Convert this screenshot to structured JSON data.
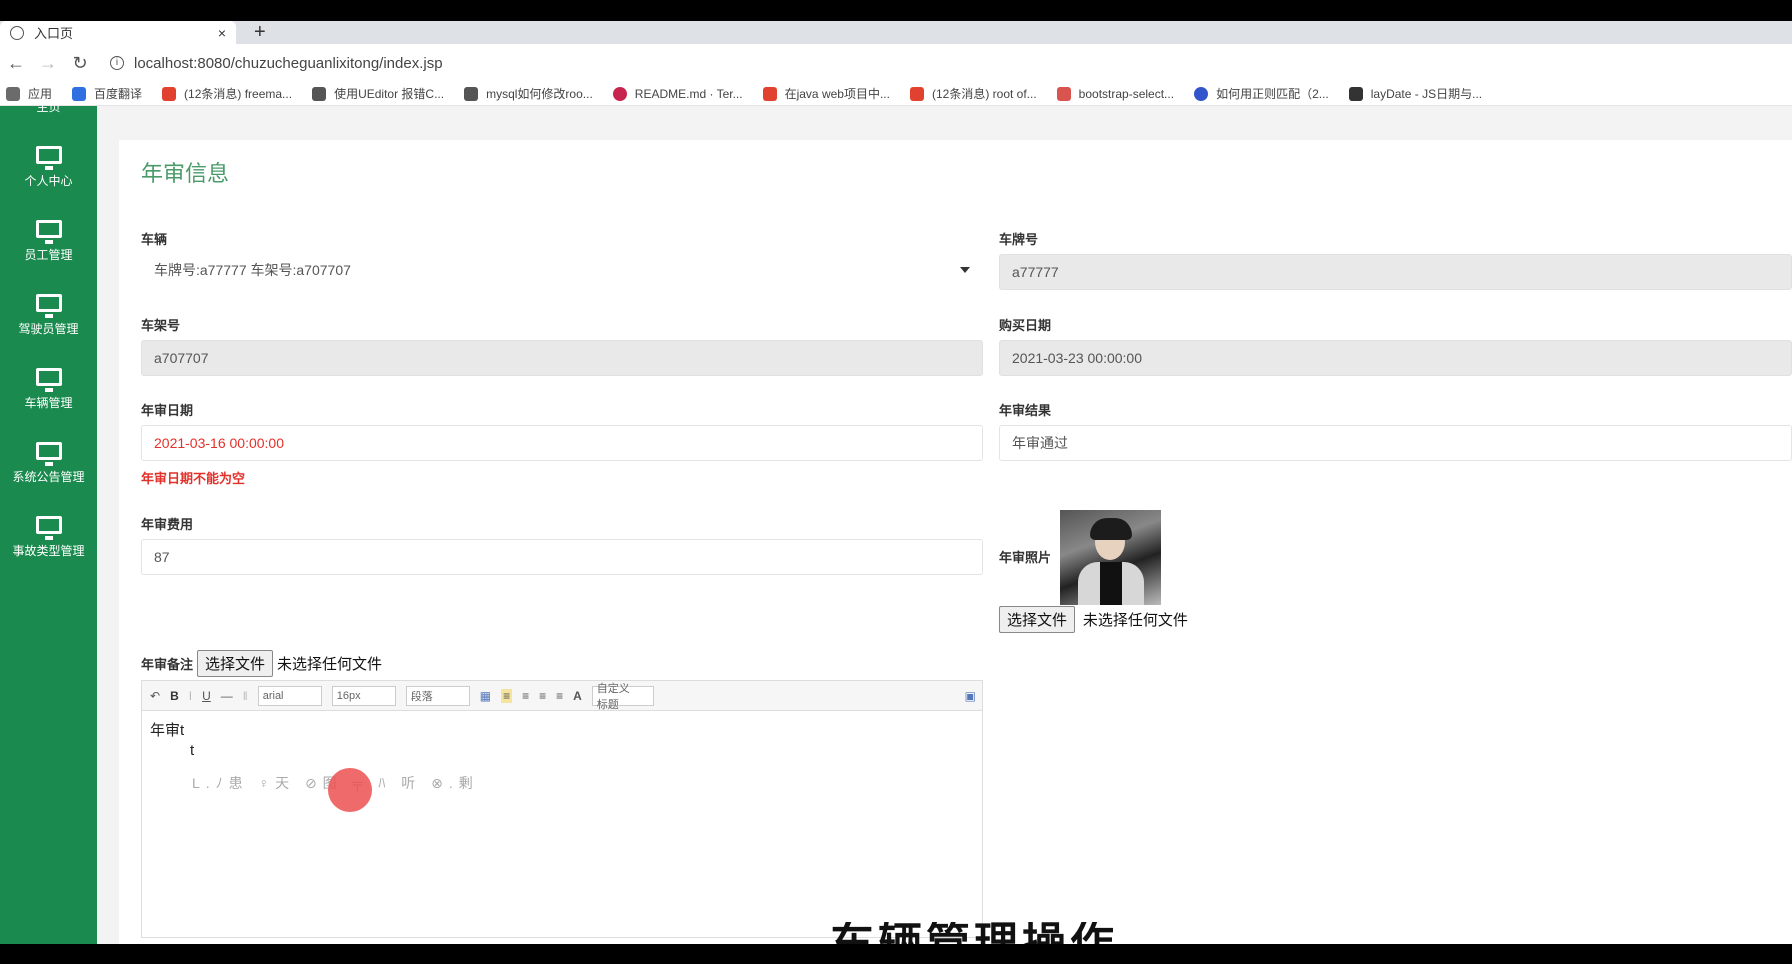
{
  "browser": {
    "tab_title": "入口页",
    "tab_close": "×",
    "new_tab": "+",
    "url": "localhost:8080/chuzucheguanlixitong/index.jsp",
    "bookmarks": [
      {
        "label": "应用",
        "color": "#6b6b6b"
      },
      {
        "label": "百度翻译",
        "color": "#2f6fe0"
      },
      {
        "label": "(12条消息) freema...",
        "color": "#e0422f"
      },
      {
        "label": "使用UEditor 报错C...",
        "color": "#555555"
      },
      {
        "label": "mysql如何修改roo...",
        "color": "#555555"
      },
      {
        "label": "README.md · Ter...",
        "color": "#c7254e"
      },
      {
        "label": "在java web项目中...",
        "color": "#e0422f"
      },
      {
        "label": "(12条消息) root of...",
        "color": "#e0422f"
      },
      {
        "label": "bootstrap-select...",
        "color": "#d9534f"
      },
      {
        "label": "如何用正则匹配（2...",
        "color": "#3355cc"
      },
      {
        "label": "layDate - JS日期与...",
        "color": "#333333"
      }
    ]
  },
  "sidebar": {
    "top_partial": "主页",
    "items": [
      {
        "label": "个人中心"
      },
      {
        "label": "员工管理"
      },
      {
        "label": "驾驶员管理"
      },
      {
        "label": "车辆管理"
      },
      {
        "label": "系统公告管理"
      },
      {
        "label": "事故类型管理"
      }
    ]
  },
  "form": {
    "title": "年审信息",
    "vehicle_label": "车辆",
    "vehicle_value": "车牌号:a77777 车架号:a707707",
    "plate_label": "车牌号",
    "plate_value": "a77777",
    "frame_label": "车架号",
    "frame_value": "a707707",
    "purchase_label": "购买日期",
    "purchase_value": "2021-03-23 00:00:00",
    "review_date_label": "年审日期",
    "review_date_value": "2021-03-16 00:00:00",
    "review_date_error": "年审日期不能为空",
    "result_label": "年审结果",
    "result_value": "年审通过",
    "fee_label": "年审费用",
    "fee_value": "87",
    "photo_label": "年审照片",
    "choose_file": "选择文件",
    "no_file": "未选择任何文件",
    "remark_label": "年审备注"
  },
  "editor": {
    "font_family": "arial",
    "font_size": "16px",
    "paragraph": "段落",
    "custom_title": "自定义标题",
    "content": "年审t",
    "line2": "t",
    "hint_text": "L.ﾉ患  ♀天  ⊘图   ╤  ﾊ  听  ⊗.剰"
  },
  "overlay": {
    "subtitle": "车辆管理操作"
  }
}
